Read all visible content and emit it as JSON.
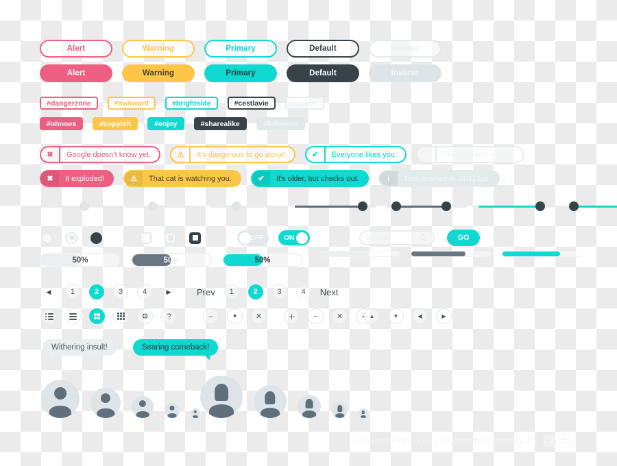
{
  "buttons": {
    "outline_row": [
      {
        "label": "Alert",
        "variant": "alert"
      },
      {
        "label": "Warning",
        "variant": "warning"
      },
      {
        "label": "Primary",
        "variant": "primary"
      },
      {
        "label": "Default",
        "variant": "default"
      },
      {
        "label": "Inverse",
        "variant": "inverse"
      }
    ],
    "solid_row": [
      {
        "label": "Alert",
        "variant": "alert"
      },
      {
        "label": "Warning",
        "variant": "warning"
      },
      {
        "label": "Primary",
        "variant": "primary"
      },
      {
        "label": "Default",
        "variant": "default"
      },
      {
        "label": "Inverse",
        "variant": "inverse"
      }
    ]
  },
  "tags": {
    "outline_row": [
      {
        "label": "#dangerzone",
        "variant": "alert"
      },
      {
        "label": "#awkward",
        "variant": "warning"
      },
      {
        "label": "#brightside",
        "variant": "primary"
      },
      {
        "label": "#cestlavie",
        "variant": "default"
      },
      {
        "label": "#subtle",
        "variant": "inverse"
      }
    ],
    "solid_row": [
      {
        "label": "#ohnoes",
        "variant": "alert"
      },
      {
        "label": "#copyleft",
        "variant": "warning"
      },
      {
        "label": "#enjoy",
        "variant": "primary"
      },
      {
        "label": "#sharealike",
        "variant": "default"
      },
      {
        "label": "#followme",
        "variant": "inverse"
      }
    ]
  },
  "alerts": {
    "outline_row": [
      {
        "icon": "✖",
        "icon_name": "close-icon",
        "message": "Google doesn't know yet.",
        "variant": "alert"
      },
      {
        "icon": "⚠",
        "icon_name": "warning-icon",
        "message": "It's dangerous to go alone!",
        "variant": "warning"
      },
      {
        "icon": "✔",
        "icon_name": "check-icon",
        "message": "Everyone likes you.",
        "variant": "primary"
      },
      {
        "icon": "i",
        "icon_name": "info-icon",
        "message": "This moment is gone.",
        "variant": "inverse"
      }
    ],
    "solid_row": [
      {
        "icon": "✖",
        "icon_name": "close-icon",
        "message": "It exploded!",
        "variant": "alert"
      },
      {
        "icon": "⚠",
        "icon_name": "warning-icon",
        "message": "That cat is watching you.",
        "variant": "warning"
      },
      {
        "icon": "✔",
        "icon_name": "check-icon",
        "message": "It's older, but checks out.",
        "variant": "primary"
      },
      {
        "icon": "i",
        "icon_name": "info-icon",
        "message": "Task finished in .00413µs.",
        "variant": "inverse"
      }
    ]
  },
  "sliders": [
    {
      "name": "slider-light-1",
      "fill_percent": 0,
      "knob": "light",
      "knob_percent": 55
    },
    {
      "name": "slider-light-2",
      "fill_percent": 0,
      "knob": "light",
      "knob_percent": 33
    },
    {
      "name": "slider-light-3",
      "fill_percent": 0,
      "knob": "light",
      "knob_percent": 28
    },
    {
      "name": "slider-dark",
      "fill_percent": 82,
      "knob": "dark",
      "knob_percent": 82
    },
    {
      "name": "slider-range-dark",
      "fill_percent": 0,
      "knob": "dark",
      "range": [
        12,
        75
      ]
    },
    {
      "name": "slider-cyan",
      "fill_percent": 74,
      "knob": "dark",
      "knob_percent": 74
    },
    {
      "name": "slider-range-cyan",
      "fill_percent": 0,
      "knob": "dark",
      "range": [
        22,
        82
      ]
    }
  ],
  "radios": [
    {
      "name": "radio-empty",
      "state": "empty"
    },
    {
      "name": "radio-light",
      "state": "light"
    },
    {
      "name": "radio-filled",
      "state": "filled"
    }
  ],
  "checkboxes": [
    {
      "name": "checkbox-empty",
      "state": "empty"
    },
    {
      "name": "checkbox-light",
      "state": "light"
    },
    {
      "name": "checkbox-filled",
      "state": "filled"
    }
  ],
  "toggles": [
    {
      "label": "OFF",
      "state": "off"
    },
    {
      "label": "ON",
      "state": "on"
    }
  ],
  "search": {
    "placeholder": "Search",
    "value": "",
    "icon": "search-icon",
    "go_label": "GO"
  },
  "progress": {
    "labeled": [
      {
        "label": "50%",
        "percent": 50,
        "fill": "light"
      },
      {
        "label": "50%",
        "percent": 50,
        "fill": "dark"
      },
      {
        "label": "50%",
        "percent": 50,
        "fill": "cyan"
      }
    ],
    "thin": [
      {
        "percent": 60,
        "fill": "light"
      },
      {
        "percent": 68,
        "fill": "dark"
      },
      {
        "percent": 72,
        "fill": "cyan"
      }
    ]
  },
  "pagination": {
    "arrows": {
      "prev_icon": "◀",
      "next_icon": "▶",
      "pages": [
        "1",
        "2",
        "3",
        "4"
      ],
      "active": "2"
    },
    "words": {
      "prev_label": "Prev",
      "next_label": "Next",
      "pages": [
        "1",
        "2",
        "3",
        "4"
      ],
      "active": "2"
    }
  },
  "icon_buttons": [
    {
      "name": "list-bullets-icon",
      "glyph": "bullets",
      "active": false
    },
    {
      "name": "list-lines-icon",
      "glyph": "lines",
      "active": false
    },
    {
      "name": "grid-four-icon",
      "glyph": "g4",
      "active": true
    },
    {
      "name": "grid-nine-icon",
      "glyph": "g9",
      "active": false
    },
    {
      "name": "gear-icon",
      "glyph": "⚙",
      "active": false
    },
    {
      "name": "question-icon",
      "glyph": "?",
      "active": false
    },
    {
      "name": "minimize-icon",
      "glyph": "–",
      "active": false
    },
    {
      "name": "maximize-icon",
      "glyph": "■",
      "active": false
    },
    {
      "name": "close-icon",
      "glyph": "✕",
      "active": false
    },
    {
      "name": "plus-icon",
      "glyph": "＋",
      "active": false
    },
    {
      "name": "minus-icon",
      "glyph": "−",
      "active": false
    },
    {
      "name": "multiply-icon",
      "glyph": "✕",
      "active": false
    },
    {
      "name": "divide-icon",
      "glyph": "÷",
      "active": false
    },
    {
      "name": "triangle-up-icon",
      "glyph": "▲",
      "active": false
    },
    {
      "name": "triangle-down-icon",
      "glyph": "▼",
      "active": false
    },
    {
      "name": "triangle-left-icon",
      "glyph": "◀",
      "active": false
    },
    {
      "name": "triangle-right-icon",
      "glyph": "▶",
      "active": false
    }
  ],
  "bubbles": [
    {
      "text": "Withering insult!",
      "style": "grey"
    },
    {
      "text": "Searing comeback!",
      "style": "cyan"
    }
  ],
  "avatars": {
    "round_set_sizes": [
      56,
      44,
      32,
      22,
      14
    ],
    "square_set_sizes": [
      62,
      48,
      34,
      23,
      14
    ]
  },
  "footer": {
    "credit": "Basics Wireframe Kit 1.0 by jordan@jordanblakey.com",
    "badge_top": "PUBLIC",
    "badge_bottom": "DOMAIN",
    "badge_mark": "Ⓒ"
  },
  "colors": {
    "alert": "#ec5f82",
    "warning": "#fcc749",
    "primary": "#0fd9d0",
    "default": "#384349",
    "inverse": "#dde5e8",
    "slate": "#5f6f7c"
  }
}
